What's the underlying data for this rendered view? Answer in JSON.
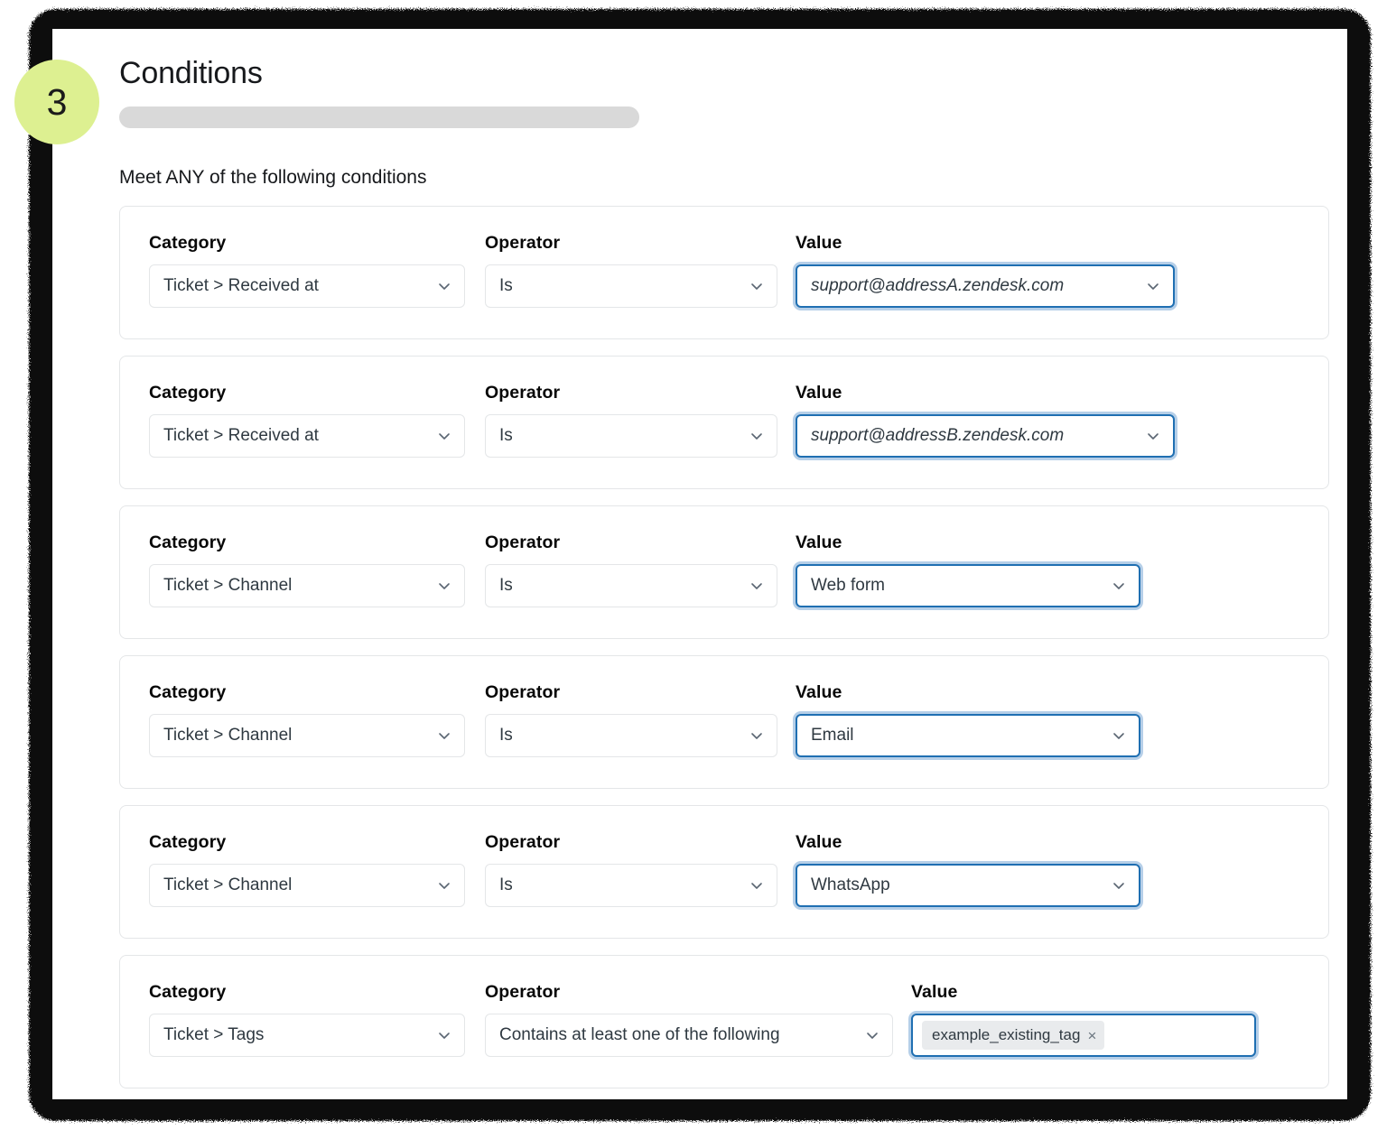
{
  "badge": {
    "step": "3"
  },
  "header": {
    "title": "Conditions",
    "subtitle_placeholder": ""
  },
  "section": {
    "match_label": "Meet ANY of the following conditions"
  },
  "labels": {
    "category": "Category",
    "operator": "Operator",
    "value": "Value"
  },
  "colors": {
    "badge_bg": "#ddf091",
    "focus_border": "#1f6fb2",
    "focus_glow": "#b6cfe8",
    "card_border": "#e4e6e8",
    "placeholder_gray": "#d9d9d9",
    "tag_bg": "#e9ebed",
    "chevron": "#5a6572"
  },
  "conditions": [
    {
      "category": "Ticket > Received at",
      "operator": "Is",
      "value": "support@addressA.zendesk.com",
      "value_focused": true,
      "value_italic": true,
      "value_width": "wide"
    },
    {
      "category": "Ticket > Received at",
      "operator": "Is",
      "value": "support@addressB.zendesk.com",
      "value_focused": true,
      "value_italic": true,
      "value_width": "wide"
    },
    {
      "category": "Ticket > Channel",
      "operator": "Is",
      "value": "Web form",
      "value_focused": true,
      "value_italic": false,
      "value_width": "narrow"
    },
    {
      "category": "Ticket > Channel",
      "operator": "Is",
      "value": "Email",
      "value_focused": true,
      "value_italic": false,
      "value_width": "narrow"
    },
    {
      "category": "Ticket > Channel",
      "operator": "Is",
      "value": "WhatsApp",
      "value_focused": true,
      "value_italic": false,
      "value_width": "narrow"
    },
    {
      "category": "Ticket > Tags",
      "operator": "Contains at least one of the following",
      "value_tag": "example_existing_tag",
      "value_tag_remove": "×",
      "value_focused": true,
      "value_width": "tags"
    }
  ]
}
